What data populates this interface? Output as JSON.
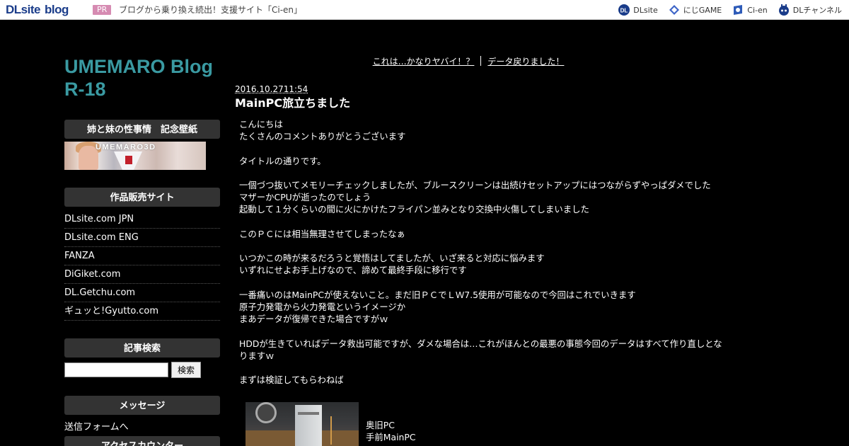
{
  "topbar": {
    "logo_main": "DLsite",
    "logo_sub": "blog",
    "pr_badge": "PR",
    "pr_text": "ブログから乗り換え続出！支援サイト「Ci-en」",
    "nav": [
      {
        "label": "DLsite",
        "icon": "dlsite-icon"
      },
      {
        "label": "にじGAME",
        "icon": "nijigame-icon"
      },
      {
        "label": "Ci-en",
        "icon": "cien-icon"
      },
      {
        "label": "DLチャンネル",
        "icon": "dlchannel-icon"
      }
    ]
  },
  "sidebar": {
    "blog_title": "UMEMARO Blog R-18",
    "wallpaper_heading": "姉と妹の性事情　記念壁紙",
    "wallpaper_watermark": "UMEMARO3D",
    "shop_heading": "作品販売サイト",
    "shops": [
      "DLsite.com JPN",
      "DLsite.com ENG",
      "FANZA",
      "DiGiket.com",
      "DL.Getchu.com",
      "ギュッと!Gyutto.com"
    ],
    "search_heading": "記事検索",
    "search_button": "検索",
    "search_value": "",
    "message_heading": "メッセージ",
    "message_link": "送信フォームへ",
    "counter_heading": "アクセスカウンター"
  },
  "nav_links": {
    "prev": "これは…かなりヤバイ！？",
    "next": "データ戻りました！"
  },
  "post": {
    "date": "2016.10.2711:54",
    "title": "MainPC旅立ちました",
    "body": [
      "こんにちは",
      "たくさんのコメントありがとうございます",
      "",
      "タイトルの通りです。",
      "",
      "一個づつ抜いてメモリーチェックしましたが、ブルースクリーンは出続けセットアップにはつながらずやっぱダメでした",
      "マザーかCPUが逝ったのでしょう",
      "起動して１分くらいの間に火にかけたフライパン並みとなり交換中火傷してしまいました",
      "",
      "このＰＣには相当無理させてしまったなぁ",
      "",
      "いつかこの時が来るだろうと覚悟はしてましたが、いざ来ると対応に悩みます",
      "いずれにせよお手上げなので、諦めて最終手段に移行です",
      "",
      "一番痛いのはMainPCが使えないこと。まだ旧ＰＣでＬＷ7.5使用が可能なので今回はこれでいきます",
      "原子力発電から火力発電というイメージか",
      "まあデータが復帰できた場合ですがｗ",
      "",
      "HDDが生きていればデータ救出可能ですが、ダメな場合は…これがほんとの最悪の事態今回のデータはすべて作り直しとなりますｗ",
      "",
      "まずは検証してもらわねば"
    ],
    "photo_caption_1": "奥旧PC",
    "photo_caption_2": "手前MainPC"
  }
}
